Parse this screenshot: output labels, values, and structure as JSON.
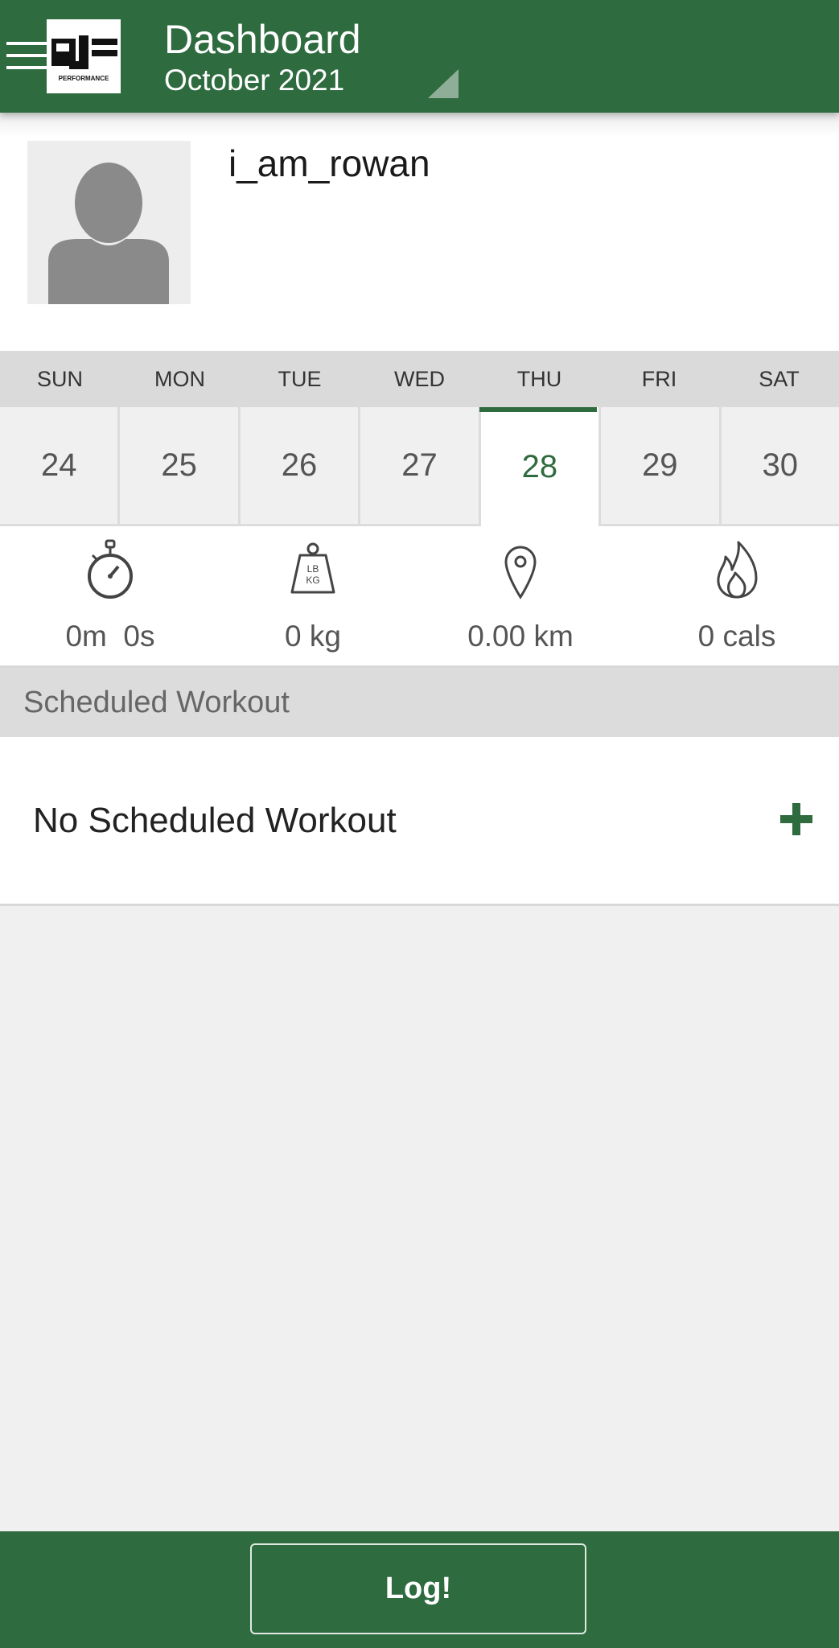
{
  "header": {
    "title": "Dashboard",
    "subtitle": "October 2021",
    "logo_text": "PJ PERFORMANCE",
    "menu_icon": "menu-icon",
    "dropdown_icon": "dropdown-triangle-icon",
    "background_color": "#2e6b3f"
  },
  "profile": {
    "username": "i_am_rowan",
    "avatar_icon": "default-avatar-icon"
  },
  "week": {
    "weekdays": [
      "SUN",
      "MON",
      "TUE",
      "WED",
      "THU",
      "FRI",
      "SAT"
    ],
    "days": [
      "24",
      "25",
      "26",
      "27",
      "28",
      "29",
      "30"
    ],
    "selected_index": 4,
    "accent_color": "#2e6b3f"
  },
  "stats": [
    {
      "icon": "stopwatch-icon",
      "value": "0m  0s"
    },
    {
      "icon": "weight-icon",
      "value": "0 kg"
    },
    {
      "icon": "location-pin-icon",
      "value": "0.00 km"
    },
    {
      "icon": "flame-icon",
      "value": "0 cals"
    }
  ],
  "weight_icon_labels": {
    "top": "LB",
    "bottom": "KG"
  },
  "scheduled": {
    "section_title": "Scheduled Workout",
    "empty_text": "No Scheduled Workout",
    "add_icon": "add-icon"
  },
  "bottom": {
    "log_label": "Log!"
  }
}
